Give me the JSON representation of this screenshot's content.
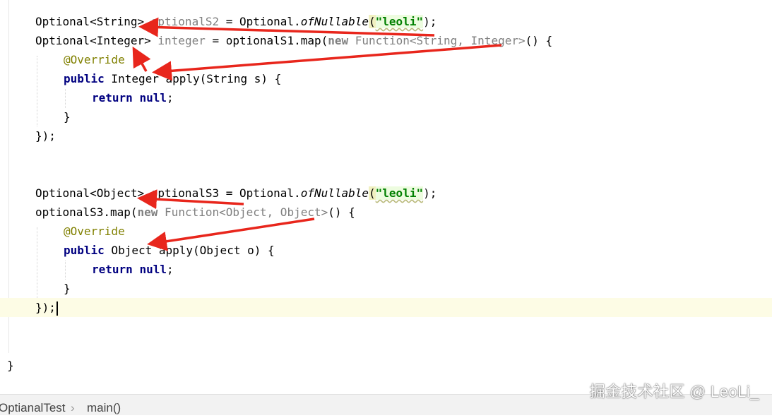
{
  "code": {
    "l1": {
      "type": "Optional<String>",
      "var": "optionalS2",
      "eq": " = Optional.",
      "method": "ofNullable",
      "open": "(",
      "arg": "\"leoli\"",
      "close": ");"
    },
    "l2": {
      "type": "Optional<Integer>",
      "var": "integer",
      "rest": " = optionalS1.map(",
      "new_kw": "new",
      "anon": "Function<String, Integer>",
      "tail": "() {"
    },
    "l3": {
      "annotation": "@Override"
    },
    "l4": {
      "public_kw": "public",
      "sig": " Integer apply(String s) {"
    },
    "l5": {
      "return_kw": "return",
      "null_kw": "null",
      "semi": ";"
    },
    "l6": {
      "brace": "}"
    },
    "l7": {
      "close": "});"
    },
    "l8": {
      "type": "Optional<Object>",
      "var": "optionalS3",
      "eq": " = Optional.",
      "method": "ofNullable",
      "open": "(",
      "arg": "\"leoli\"",
      "close": ");"
    },
    "l9": {
      "call": "optionalS3.map(",
      "new_kw": "new",
      "anon": "Function<Object, Object>",
      "tail": "() {"
    },
    "l10": {
      "annotation": "@Override"
    },
    "l11": {
      "public_kw": "public",
      "sig": " Object apply(Object o) {"
    },
    "l12": {
      "return_kw": "return",
      "null_kw": "null",
      "semi": ";"
    },
    "l13": {
      "brace": "}"
    },
    "l14": {
      "close": "});"
    },
    "l15": {
      "brace": "}"
    }
  },
  "breadcrumb": {
    "file": "OptianalTest",
    "separator": "›",
    "method": "main()"
  },
  "watermark": "掘金技术社区 @ LeoLi_",
  "colors": {
    "arrow": "#e8261c",
    "keyword": "#000080",
    "string": "#008000",
    "annotation": "#808000",
    "unused": "#808080",
    "current_line": "#fdfce5"
  }
}
